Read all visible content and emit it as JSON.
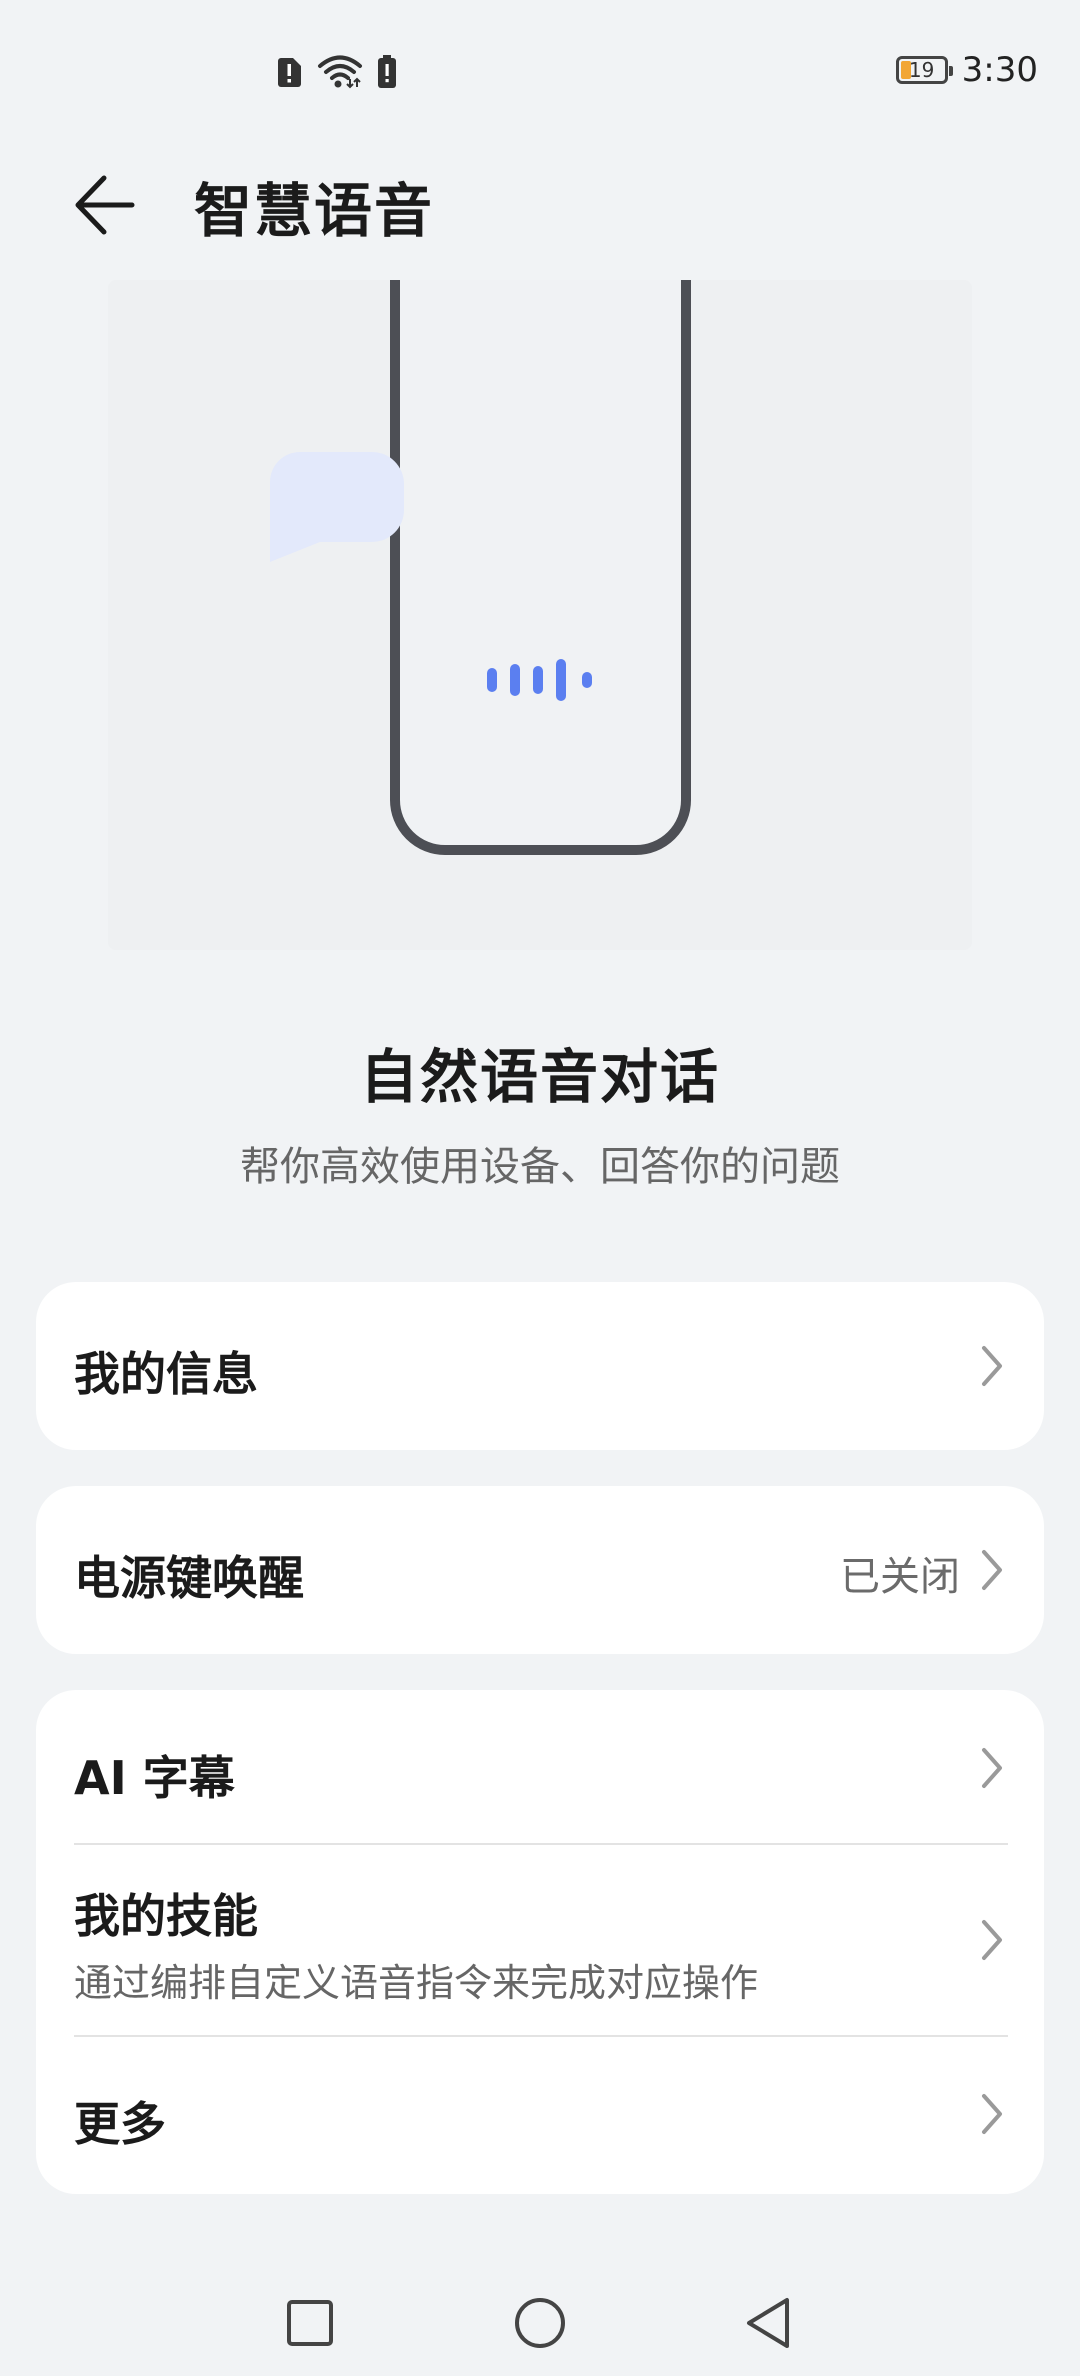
{
  "status_bar": {
    "time": "3:30",
    "battery_level": "19",
    "icons": [
      "sim-alert-icon",
      "wifi-icon",
      "battery-alert-icon"
    ]
  },
  "header": {
    "title": "智慧语音",
    "back_icon": "arrow-left-icon"
  },
  "hero": {
    "illustration_accent": "#5b7ff0",
    "title": "自然语音对话",
    "subtitle": "帮你高效使用设备、回答你的问题"
  },
  "settings": {
    "my_info": {
      "label": "我的信息"
    },
    "power_key_wake": {
      "label": "电源键唤醒",
      "value": "已关闭"
    },
    "ai_subtitles": {
      "label": "AI 字幕"
    },
    "my_skills": {
      "label": "我的技能",
      "description": "通过编排自定义语音指令来完成对应操作"
    },
    "more": {
      "label": "更多"
    }
  },
  "nav_bar": {
    "icons": [
      "recents-square-icon",
      "home-circle-icon",
      "back-triangle-icon"
    ]
  }
}
